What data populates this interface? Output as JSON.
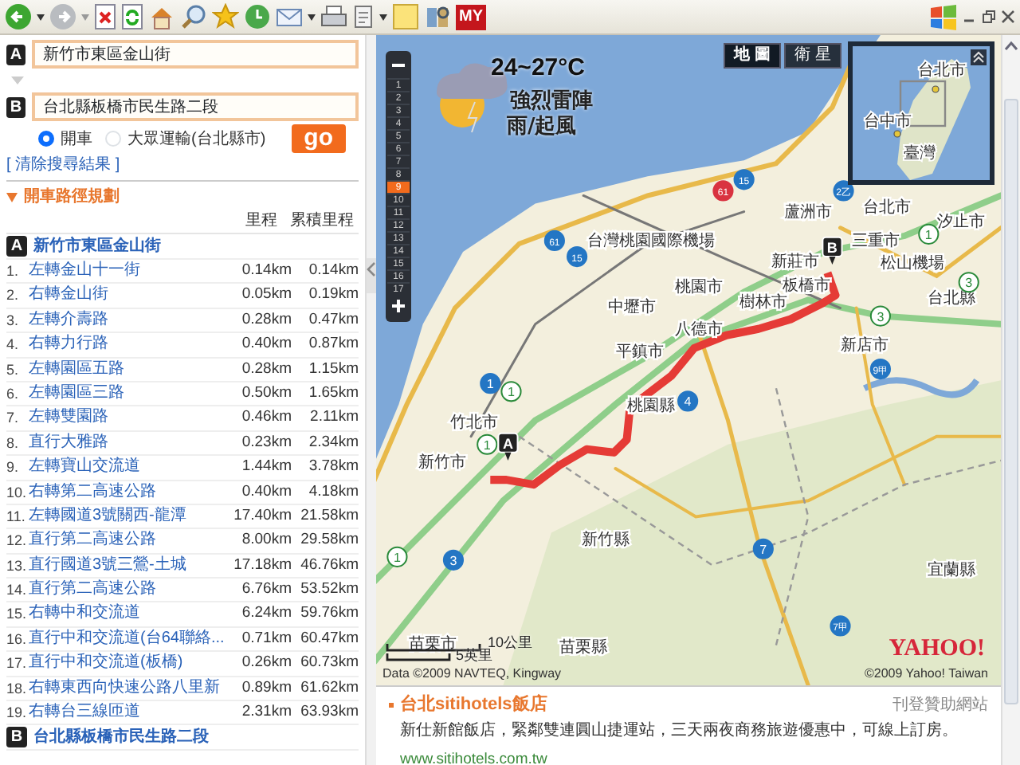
{
  "toolbar": {
    "logo_text": "MY"
  },
  "route_form": {
    "from_marker": "A",
    "from": "新竹市東區金山街",
    "to_marker": "B",
    "to": "台北縣板橋市民生路二段",
    "modes": [
      {
        "label": "開車",
        "selected": true
      },
      {
        "label": "大眾運輸(台北縣市)",
        "selected": false
      }
    ],
    "go": "go",
    "clear_link": "[ 清除搜尋結果 ]"
  },
  "directions": {
    "title": "開車路徑規劃",
    "expanded": true,
    "columns": [
      "里程",
      "累積里程"
    ],
    "start": {
      "marker": "A",
      "name": "新竹市東區金山街"
    },
    "steps": [
      {
        "num": "1.",
        "text": "左轉金山十一街",
        "dist": "0.14km",
        "total": "0.14km"
      },
      {
        "num": "2.",
        "text": "右轉金山街",
        "dist": "0.05km",
        "total": "0.19km"
      },
      {
        "num": "3.",
        "text": "左轉介壽路",
        "dist": "0.28km",
        "total": "0.47km"
      },
      {
        "num": "4.",
        "text": "右轉力行路",
        "dist": "0.40km",
        "total": "0.87km"
      },
      {
        "num": "5.",
        "text": "左轉園區五路",
        "dist": "0.28km",
        "total": "1.15km"
      },
      {
        "num": "6.",
        "text": "左轉園區三路",
        "dist": "0.50km",
        "total": "1.65km"
      },
      {
        "num": "7.",
        "text": "左轉雙園路",
        "dist": "0.46km",
        "total": "2.11km"
      },
      {
        "num": "8.",
        "text": "直行大雅路",
        "dist": "0.23km",
        "total": "2.34km"
      },
      {
        "num": "9.",
        "text": "左轉寶山交流道",
        "dist": "1.44km",
        "total": "3.78km"
      },
      {
        "num": "10.",
        "text": "右轉第二高速公路",
        "dist": "0.40km",
        "total": "4.18km"
      },
      {
        "num": "11.",
        "text": "左轉國道3號關西-龍潭",
        "dist": "17.40km",
        "total": "21.58km"
      },
      {
        "num": "12.",
        "text": "直行第二高速公路",
        "dist": "8.00km",
        "total": "29.58km"
      },
      {
        "num": "13.",
        "text": "直行國道3號三鶯-土城",
        "dist": "17.18km",
        "total": "46.76km"
      },
      {
        "num": "14.",
        "text": "直行第二高速公路",
        "dist": "6.76km",
        "total": "53.52km"
      },
      {
        "num": "15.",
        "text": "右轉中和交流道",
        "dist": "6.24km",
        "total": "59.76km"
      },
      {
        "num": "16.",
        "text": "直行中和交流道(台64聯絡...",
        "dist": "0.71km",
        "total": "60.47km"
      },
      {
        "num": "17.",
        "text": "直行中和交流道(板橋)",
        "dist": "0.26km",
        "total": "60.73km"
      },
      {
        "num": "18.",
        "text": "右轉東西向快速公路八里新",
        "dist": "0.89km",
        "total": "61.62km"
      },
      {
        "num": "19.",
        "text": "右轉台三線匝道",
        "dist": "2.31km",
        "total": "63.93km"
      }
    ],
    "end": {
      "marker": "B",
      "name": "台北縣板橋市民生路二段"
    }
  },
  "map": {
    "view_buttons": [
      {
        "label": "地 圖",
        "selected": true
      },
      {
        "label": "衛 星",
        "selected": false
      }
    ],
    "zoom": {
      "levels": [
        {
          "label": "1",
          "selected": false
        },
        {
          "label": "2",
          "selected": false
        },
        {
          "label": "3",
          "selected": false
        },
        {
          "label": "4",
          "selected": false
        },
        {
          "label": "5",
          "selected": false
        },
        {
          "label": "6",
          "selected": false
        },
        {
          "label": "7",
          "selected": false
        },
        {
          "label": "8",
          "selected": false
        },
        {
          "label": "9",
          "selected": true
        },
        {
          "label": "10",
          "selected": false
        },
        {
          "label": "11",
          "selected": false
        },
        {
          "label": "12",
          "selected": false
        },
        {
          "label": "13",
          "selected": false
        },
        {
          "label": "14",
          "selected": false
        },
        {
          "label": "15",
          "selected": false
        },
        {
          "label": "16",
          "selected": false
        },
        {
          "label": "17",
          "selected": false
        }
      ]
    },
    "weather": {
      "temp": "24~27°C",
      "lines": [
        "強烈雷陣",
        "雨/起風"
      ]
    },
    "labels": [
      "台北市",
      "蘆洲市",
      "三重市",
      "汐止市",
      "松山機場",
      "新莊市",
      "板橋市",
      "台北縣",
      "樹林市",
      "台灣桃園國際機場",
      "桃園市",
      "中壢市",
      "八德市",
      "平鎮市",
      "新店市",
      "桃園縣",
      "竹北市",
      "新竹市",
      "新竹縣",
      "宜蘭縣",
      "苗栗市",
      "苗栗縣"
    ],
    "shields": [
      {
        "label": "61",
        "kind": "coastal"
      },
      {
        "label": "15",
        "kind": "provincial"
      },
      {
        "label": "2乙",
        "kind": "provincial"
      },
      {
        "label": "61",
        "kind": "provincial"
      },
      {
        "label": "15",
        "kind": "provincial"
      },
      {
        "label": "1",
        "kind": "provincial"
      },
      {
        "label": "4",
        "kind": "provincial"
      },
      {
        "label": "9甲",
        "kind": "provincial"
      },
      {
        "label": "7",
        "kind": "provincial"
      },
      {
        "label": "3",
        "kind": "provincial"
      },
      {
        "label": "7甲",
        "kind": "provincial"
      },
      {
        "label": "1",
        "kind": "freeway"
      },
      {
        "label": "3",
        "kind": "freeway"
      },
      {
        "label": "3",
        "kind": "freeway"
      },
      {
        "label": "1",
        "kind": "freeway"
      },
      {
        "label": "1",
        "kind": "freeway"
      },
      {
        "label": "1",
        "kind": "freeway"
      }
    ],
    "markers": [
      "A",
      "B"
    ],
    "minimap": {
      "labels": [
        "台北市",
        "台中市",
        "臺灣"
      ]
    },
    "scale": [
      "10公里",
      "5英里"
    ],
    "logo": "YAHOO!",
    "credits": [
      "Data ©2009 NAVTEQ, Kingway",
      "©2009 Yahoo! Taiwan"
    ]
  },
  "ads": {
    "header": "刊登贊助網站",
    "items": [
      {
        "title": "台北sitihotels飯店",
        "text": "新仕新館飯店，緊鄰雙連圓山捷運站，三天兩夜商務旅遊優惠中，可線上訂房。",
        "url": "www.sitihotels.com.tw"
      }
    ]
  }
}
